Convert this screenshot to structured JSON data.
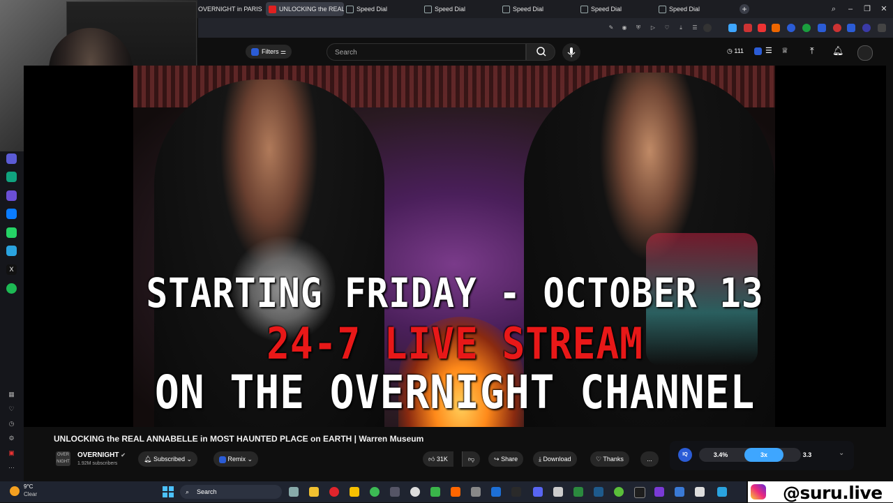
{
  "browser": {
    "tabs": [
      {
        "label": "OVERNIGHT in PARIS CAT..."
      },
      {
        "label": "UNLOCKING the REAL"
      },
      {
        "label": "Speed Dial"
      },
      {
        "label": "Speed Dial"
      },
      {
        "label": "Speed Dial"
      },
      {
        "label": "Speed Dial"
      },
      {
        "label": "Speed Dial"
      }
    ],
    "new_tab": "+"
  },
  "youtube": {
    "filters_label": "Filters",
    "search_placeholder": "Search",
    "badge_count": "111"
  },
  "video": {
    "overlay_line1": "STARTING FRIDAY - OCTOBER 13",
    "overlay_line2": "24-7 LIVE STREAM",
    "overlay_line3": "ON THE OVERNIGHT CHANNEL"
  },
  "meta": {
    "title": "UNLOCKING the REAL ANNABELLE in MOST HAUNTED PLACE on EARTH | Warren Museum",
    "channel_name": "OVERNIGHT",
    "subscribers": "1.92M subscribers",
    "avatar_text": "OVER NIGHT",
    "subscribed_label": "Subscribed",
    "remix_label": "Remix",
    "likes": "31K",
    "share_label": "Share",
    "download_label": "Download",
    "thanks_label": "Thanks",
    "more_label": "..."
  },
  "speed_panel": {
    "left_value": "3.4%",
    "mid_value": "3x",
    "right_value": "3.3"
  },
  "taskbar": {
    "weather_temp": "9°C",
    "weather_desc": "Clear",
    "search_label": "Search"
  },
  "watermark": {
    "handle": "@suru.live"
  },
  "colors": {
    "accent_blue": "#3ea6ff",
    "overlay_red": "#e81818",
    "yt_bg": "#0f0f0f"
  }
}
